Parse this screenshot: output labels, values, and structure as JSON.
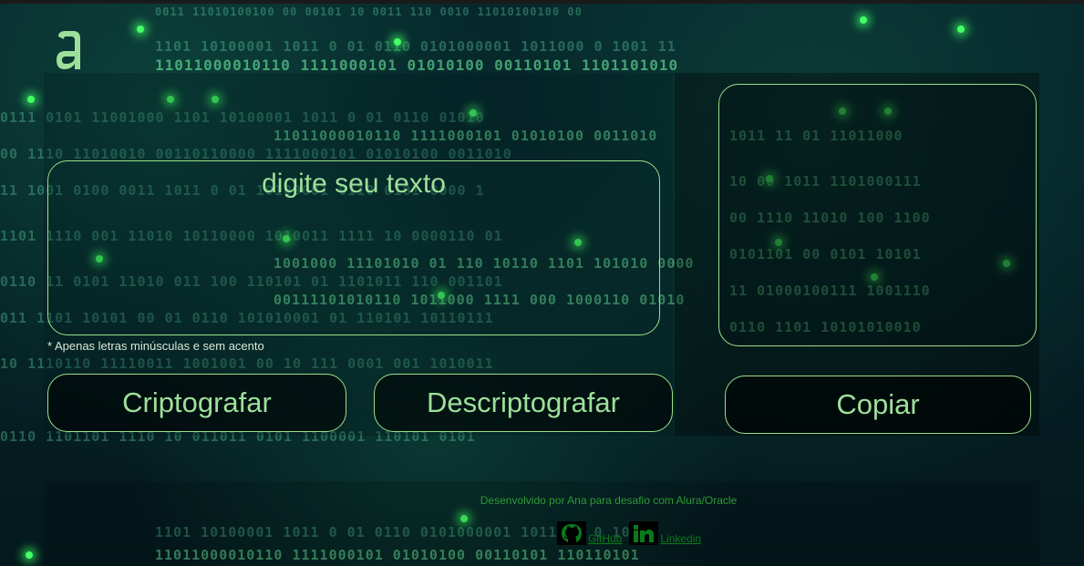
{
  "colors": {
    "accent": "#9ee09a",
    "border": "#9ae08a",
    "background": "#041b1f",
    "footer_text": "#2e9a35",
    "link": "#0a7a1a"
  },
  "logo": {
    "icon": "alura-a-logo-icon"
  },
  "input": {
    "placeholder": "digite seu texto"
  },
  "hint": "* Apenas letras minúsculas e sem acento",
  "buttons": {
    "encrypt": "Criptografar",
    "decrypt": "Descriptografar",
    "copy": "Copiar"
  },
  "footer": {
    "credit": "Desenvolvido por Ana para desafio com Alura/Oracle",
    "links": [
      {
        "label": "GitHub",
        "icon": "github-icon"
      },
      {
        "label": "Linkedin",
        "icon": "linkedin-icon"
      }
    ]
  }
}
